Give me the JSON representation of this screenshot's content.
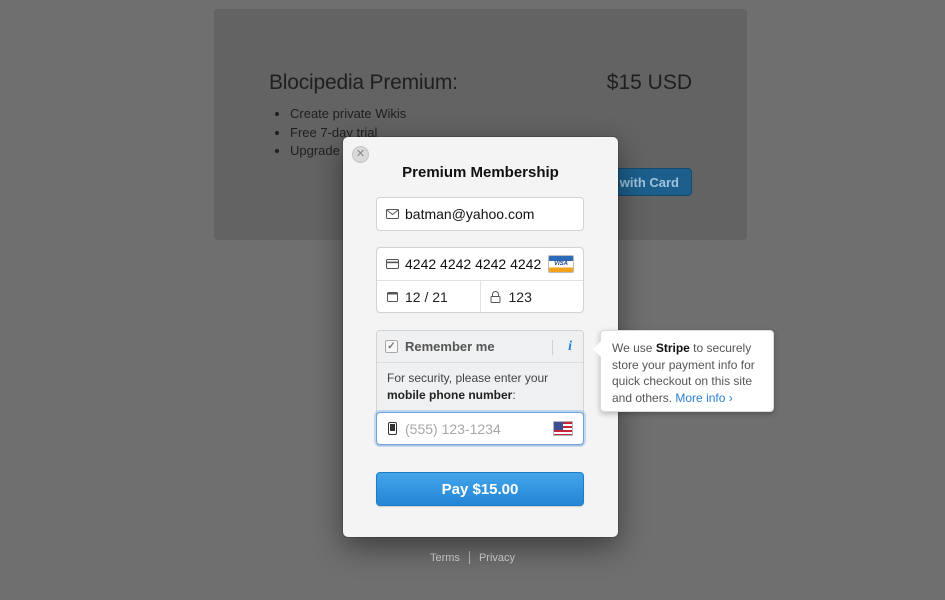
{
  "background": {
    "title": "Blocipedia Premium:",
    "price": "$15 USD",
    "features": [
      "Create private Wikis",
      "Free 7-day trial",
      "Upgrade"
    ],
    "pay_button_label": "with Card"
  },
  "footer": {
    "terms": "Terms",
    "privacy": "Privacy"
  },
  "modal": {
    "title": "Premium Membership",
    "email": "batman@yahoo.com",
    "card_number": "4242 4242 4242 4242",
    "card_brand": "VISA",
    "expiry": "12 / 21",
    "cvc": "123",
    "remember_label": "Remember me",
    "info_glyph": "i",
    "security_text_prefix": "For security, please enter your",
    "security_text_bold": "mobile phone number",
    "security_text_suffix": ":",
    "phone_placeholder": "(555) 123-1234",
    "pay_label": "Pay $15.00"
  },
  "tooltip": {
    "prefix": "We use",
    "brand": "Stripe",
    "body": "to securely store your payment info for quick checkout on this site and others.",
    "more_label": "More info",
    "chevron": "›"
  },
  "icons": {
    "email": "envelope-icon",
    "card": "credit-card-icon",
    "expiry": "calendar-icon",
    "cvc": "lock-icon",
    "phone": "mobile-phone-icon",
    "flag": "us-flag-icon",
    "close": "close-icon"
  },
  "colors": {
    "accent": "#2386d6",
    "link": "#2a7fd0"
  }
}
